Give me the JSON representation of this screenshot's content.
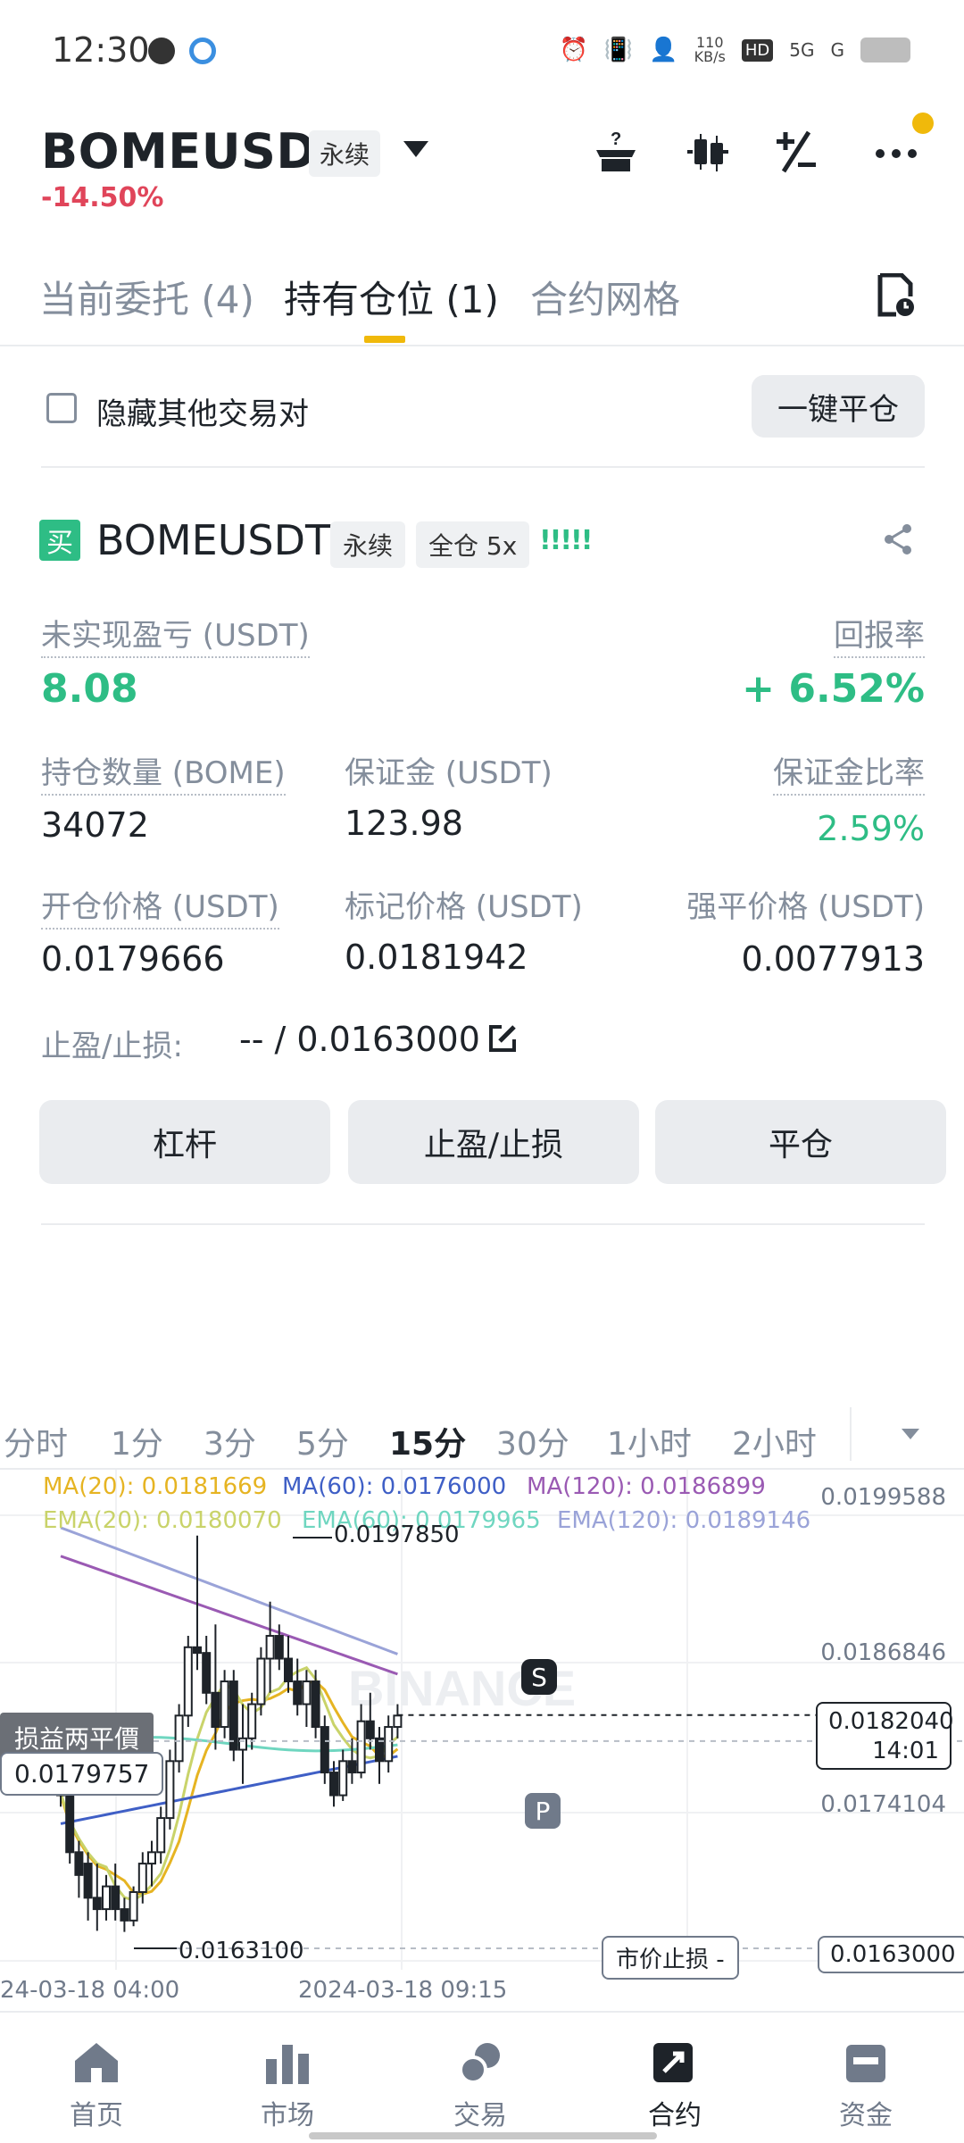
{
  "status_bar": {
    "time": "12:30",
    "net_speed": "110\nKB/s",
    "hd": "HD",
    "signal_5g": "5G",
    "signal_g": "G"
  },
  "header": {
    "symbol": "BOMEUSDT",
    "contract_type": "永续",
    "change_pct": "-14.50%",
    "icons": [
      "gift-question-icon",
      "candlestick-icon",
      "plus-minus-icon",
      "more-icon"
    ]
  },
  "tabs": [
    {
      "label": "当前委托 (4)"
    },
    {
      "label": "持有仓位 (1)",
      "active": true
    },
    {
      "label": "合约网格"
    }
  ],
  "filter": {
    "hide_other_pairs": "隐藏其他交易对",
    "close_all": "一键平仓"
  },
  "position": {
    "side_badge": "买",
    "symbol": "BOMEUSDT",
    "contract_type": "永续",
    "margin_mode": "全仓 5x",
    "signal": "!!!!!",
    "unrealized_pnl_label": "未实现盈亏 (USDT)",
    "unrealized_pnl": "8.08",
    "roe_label": "回报率",
    "roe": "+ 6.52%",
    "size_label": "持仓数量 (BOME)",
    "size": "34072",
    "margin_label": "保证金 (USDT)",
    "margin": "123.98",
    "margin_ratio_label": "保证金比率",
    "margin_ratio": "2.59%",
    "entry_price_label": "开仓价格 (USDT)",
    "entry_price": "0.0179666",
    "mark_price_label": "标记价格 (USDT)",
    "mark_price": "0.0181942",
    "liq_price_label": "强平价格 (USDT)",
    "liq_price": "0.0077913",
    "tpsl_label": "止盈/止损:",
    "tpsl_value": "-- / 0.0163000",
    "buttons": {
      "leverage": "杠杆",
      "tpsl": "止盈/止损",
      "close": "平仓"
    }
  },
  "chart": {
    "intervals": [
      "分时",
      "1分",
      "3分",
      "5分",
      "15分",
      "30分",
      "1小时",
      "2小时"
    ],
    "active_interval": "15分",
    "indicators": {
      "ma20": "MA(20): 0.0181669",
      "ma60": "MA(60): 0.0176000",
      "ma120": "MA(120): 0.0186899",
      "ema20": "EMA(20): 0.0180070",
      "ema60": "EMA(60): 0.0179965",
      "ema120": "EMA(120): 0.0189146"
    },
    "colors": {
      "ma20": "#e6b422",
      "ma60": "#3f5fc6",
      "ma120": "#9a5ab3",
      "ema20": "#c9d36a",
      "ema60": "#6fd6c0",
      "ema120": "#9aa3d8"
    },
    "price_axis": [
      "0.0199588",
      "0.0186846",
      "0.0174104"
    ],
    "high_label": "0.0197850",
    "low_label": "0.0163100",
    "breakeven_tag": "损益两平價",
    "breakeven_price": "0.0179757",
    "current_price": "0.0182040",
    "countdown": "14:01",
    "stop_loss_tag": "市价止损  -",
    "stop_loss_price": "0.0163000",
    "marker_s": "S",
    "marker_p": "P",
    "watermark": "BINANCE",
    "date_left": "24-03-18 04:00",
    "date_mid": "2024-03-18 09:15",
    "candles": [
      {
        "o": 0.0179,
        "h": 0.018,
        "l": 0.0174,
        "c": 0.0175
      },
      {
        "o": 0.0175,
        "h": 0.0176,
        "l": 0.0169,
        "c": 0.017
      },
      {
        "o": 0.017,
        "h": 0.0171,
        "l": 0.0166,
        "c": 0.0168
      },
      {
        "o": 0.0169,
        "h": 0.017,
        "l": 0.0164,
        "c": 0.0166
      },
      {
        "o": 0.0166,
        "h": 0.0169,
        "l": 0.01631,
        "c": 0.0165
      },
      {
        "o": 0.0165,
        "h": 0.0168,
        "l": 0.0164,
        "c": 0.0167
      },
      {
        "o": 0.0167,
        "h": 0.0169,
        "l": 0.0164,
        "c": 0.0165
      },
      {
        "o": 0.0165,
        "h": 0.0166,
        "l": 0.0163,
        "c": 0.0164
      },
      {
        "o": 0.0164,
        "h": 0.0167,
        "l": 0.01635,
        "c": 0.01665
      },
      {
        "o": 0.01665,
        "h": 0.017,
        "l": 0.01655,
        "c": 0.0169
      },
      {
        "o": 0.0169,
        "h": 0.0171,
        "l": 0.0167,
        "c": 0.017
      },
      {
        "o": 0.017,
        "h": 0.0174,
        "l": 0.0169,
        "c": 0.0173
      },
      {
        "o": 0.0173,
        "h": 0.0179,
        "l": 0.0172,
        "c": 0.0178
      },
      {
        "o": 0.0178,
        "h": 0.0183,
        "l": 0.0177,
        "c": 0.0182
      },
      {
        "o": 0.0182,
        "h": 0.0189,
        "l": 0.0181,
        "c": 0.0188
      },
      {
        "o": 0.0188,
        "h": 0.01978,
        "l": 0.0186,
        "c": 0.01875
      },
      {
        "o": 0.01875,
        "h": 0.0189,
        "l": 0.0183,
        "c": 0.0184
      },
      {
        "o": 0.0184,
        "h": 0.019,
        "l": 0.0179,
        "c": 0.0181
      },
      {
        "o": 0.0181,
        "h": 0.0186,
        "l": 0.018,
        "c": 0.0185
      },
      {
        "o": 0.0185,
        "h": 0.0186,
        "l": 0.0178,
        "c": 0.0179
      },
      {
        "o": 0.0179,
        "h": 0.0183,
        "l": 0.0176,
        "c": 0.018
      },
      {
        "o": 0.018,
        "h": 0.0184,
        "l": 0.0179,
        "c": 0.0183
      },
      {
        "o": 0.0183,
        "h": 0.0188,
        "l": 0.0182,
        "c": 0.0187
      },
      {
        "o": 0.0187,
        "h": 0.0192,
        "l": 0.0184,
        "c": 0.0189
      },
      {
        "o": 0.0189,
        "h": 0.019,
        "l": 0.0186,
        "c": 0.0187
      },
      {
        "o": 0.0187,
        "h": 0.0189,
        "l": 0.0184,
        "c": 0.0185
      },
      {
        "o": 0.0185,
        "h": 0.0187,
        "l": 0.0182,
        "c": 0.0183
      },
      {
        "o": 0.0183,
        "h": 0.0186,
        "l": 0.0181,
        "c": 0.0185
      },
      {
        "o": 0.0185,
        "h": 0.0186,
        "l": 0.018,
        "c": 0.0181
      },
      {
        "o": 0.0181,
        "h": 0.0182,
        "l": 0.0176,
        "c": 0.0177
      },
      {
        "o": 0.0177,
        "h": 0.0178,
        "l": 0.0174,
        "c": 0.0175
      },
      {
        "o": 0.0175,
        "h": 0.0179,
        "l": 0.01745,
        "c": 0.0178
      },
      {
        "o": 0.0178,
        "h": 0.018,
        "l": 0.0176,
        "c": 0.0177
      },
      {
        "o": 0.0177,
        "h": 0.0183,
        "l": 0.01765,
        "c": 0.01815
      },
      {
        "o": 0.01815,
        "h": 0.0184,
        "l": 0.0179,
        "c": 0.018
      },
      {
        "o": 0.018,
        "h": 0.0181,
        "l": 0.0176,
        "c": 0.0178
      },
      {
        "o": 0.0178,
        "h": 0.0182,
        "l": 0.0177,
        "c": 0.0181
      },
      {
        "o": 0.0181,
        "h": 0.0183,
        "l": 0.018,
        "c": 0.0182
      }
    ]
  },
  "bottom_nav": [
    {
      "label": "首页",
      "icon": "home-icon"
    },
    {
      "label": "市场",
      "icon": "market-bars-icon"
    },
    {
      "label": "交易",
      "icon": "trade-coins-icon"
    },
    {
      "label": "合约",
      "icon": "futures-icon",
      "active": true
    },
    {
      "label": "资金",
      "icon": "wallet-icon"
    }
  ]
}
